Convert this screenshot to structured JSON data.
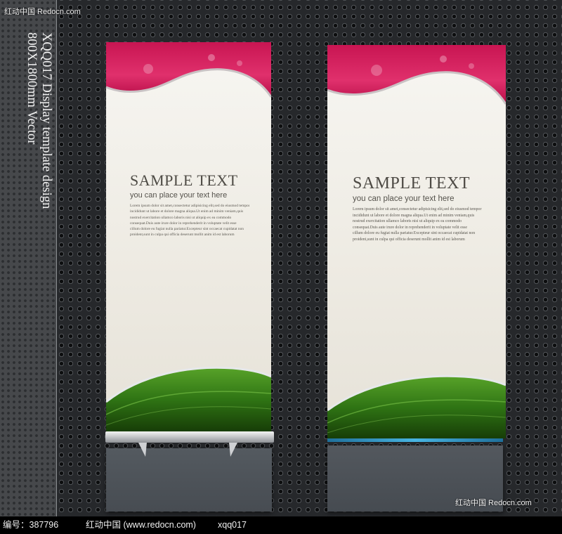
{
  "top_watermark": "红动中国 Redocn.com",
  "side_caption": {
    "line1": "XQQ017 Display template design",
    "line2": "800X1800mm Vector"
  },
  "banners": [
    {
      "title": "SAMPLE TEXT",
      "subtitle": "you can place your text here",
      "body_lines": [
        "Lorem ipsum dolor sit amet,consectetur adipisicing elit,sed do eiusmod tempor",
        "incididunt ut labore et dolore magna aliqua.Ut enim ad minim veniam,quis",
        "nostrud exercitation ullamco laboris nisi ut aliquip ex ea commodo",
        "consequat.Duis aute irure dolor in reprehenderit in voluptate velit esse",
        "cillum dolore eu fugiat nulla pariatur.Excepteur sint occaecat cupidatat non",
        "proident,sunt in culpa qui officia deserunt mollit anim id est laborum"
      ]
    },
    {
      "title": "SAMPLE TEXT",
      "subtitle": "you can place your text here",
      "body_lines": [
        "Lorem ipsum dolor sit amet,consectetur adipisicing elit,sed do eiusmod tempor",
        "incididunt ut labore et dolore magna aliqua.Ut enim ad minim veniam,quis",
        "nostrud exercitation ullamco laboris nisi ut aliquip ex ea commodo",
        "consequat.Duis aute irure dolor in reprehenderit in voluptate velit esse",
        "cillum dolore eu fugiat nulla pariatur.Excepteur sint occaecat cupidatat non",
        "proident,sunt in culpa qui officia deserunt mollit anim id est laborum"
      ]
    }
  ],
  "bottom_right_watermark": "红动中国 Redocn.com",
  "footer": {
    "id_label": "编号：387796",
    "site": "红动中国 (www.redocn.com)",
    "code": "xqq017"
  },
  "colors": {
    "magenta": "#d81b5e",
    "green": "#3f8a1c",
    "dark_green": "#1f4a0c",
    "accent_blue": "#48b5e2",
    "background": "#26282b"
  }
}
